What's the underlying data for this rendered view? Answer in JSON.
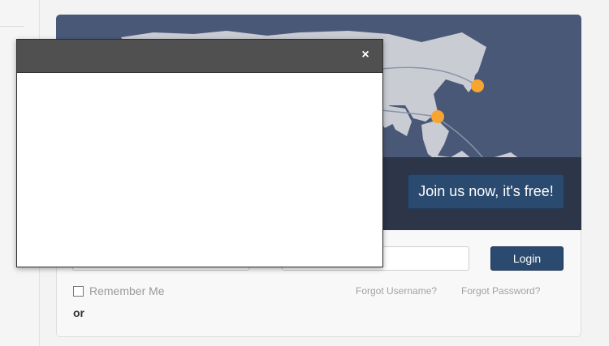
{
  "banner": {
    "cta_label": "Join us now, it's free!",
    "colors": {
      "map_background": "#4a5878",
      "landmass": "#c9ccd3",
      "marker": "#f7a531",
      "strip": "#2c3648"
    }
  },
  "login_form": {
    "username_value": "",
    "password_value": "",
    "login_label": "Login",
    "remember_label": "Remember Me",
    "forgot_username_label": "Forgot Username?",
    "forgot_password_label": "Forgot Password?",
    "or_label": "or"
  },
  "modal": {
    "close_glyph": "×"
  }
}
